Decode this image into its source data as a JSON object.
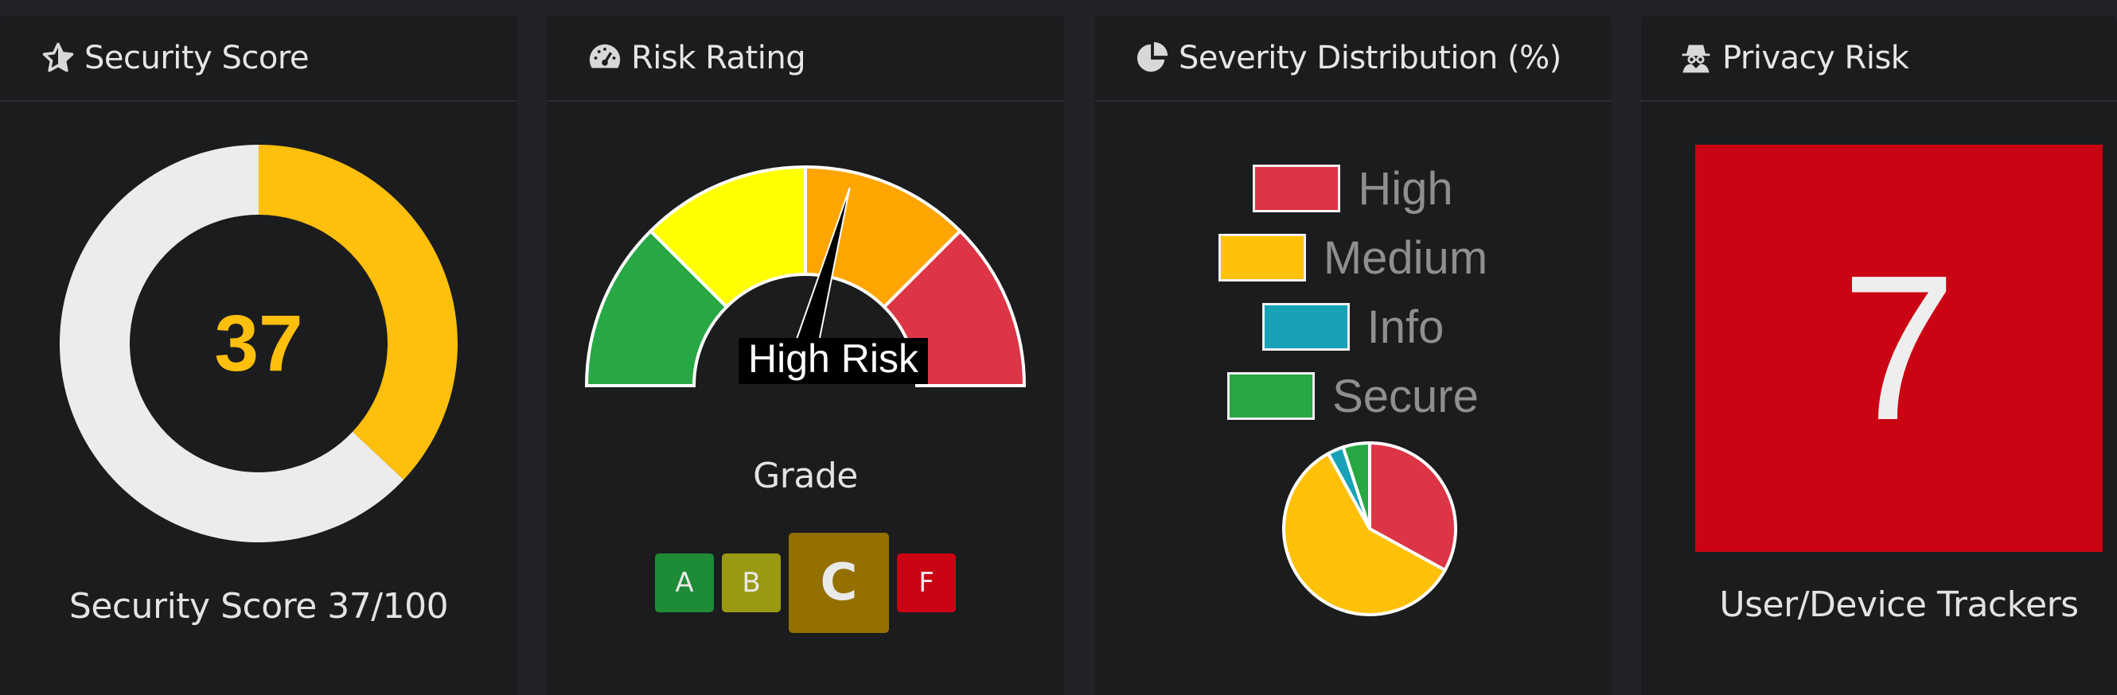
{
  "cards": {
    "security_score": {
      "title": "Security Score",
      "icon": "star-icon",
      "score": 37,
      "score_display": "37",
      "max": 100,
      "caption": "Security Score 37/100",
      "colors": {
        "fill": "#ffbf0d",
        "track": "#ececec"
      }
    },
    "risk_rating": {
      "title": "Risk Rating",
      "icon": "speedometer-icon",
      "gauge_label": "High Risk",
      "gauge_colors": [
        "#28a745",
        "#ffff00",
        "#ffa500",
        "#dc3545"
      ],
      "needle_level": 0.57,
      "grade_label": "Grade",
      "grades": [
        {
          "letter": "A",
          "color": "#1e8b36",
          "active": false
        },
        {
          "letter": "B",
          "color": "#9a9a12",
          "active": false
        },
        {
          "letter": "C",
          "color": "#947000",
          "active": true
        },
        {
          "letter": "F",
          "color": "#cb0414",
          "active": false
        }
      ]
    },
    "severity": {
      "title": "Severity Distribution (%)",
      "icon": "pie-chart-icon",
      "legend": [
        {
          "label": "High",
          "color": "#dc3545"
        },
        {
          "label": "Medium",
          "color": "#ffc107"
        },
        {
          "label": "Info",
          "color": "#17a2b8"
        },
        {
          "label": "Secure",
          "color": "#28a745"
        }
      ]
    },
    "privacy": {
      "title": "Privacy Risk",
      "icon": "user-secret-icon",
      "value": "7",
      "caption": "User/Device Trackers",
      "tile_color": "#cb0414"
    }
  },
  "chart_data": {
    "type": "pie",
    "title": "Severity Distribution (%)",
    "categories": [
      "High",
      "Medium",
      "Info",
      "Secure"
    ],
    "values": [
      33,
      59,
      3,
      5
    ],
    "colors": [
      "#dc3545",
      "#ffc107",
      "#17a2b8",
      "#28a745"
    ],
    "legend_position": "top"
  }
}
